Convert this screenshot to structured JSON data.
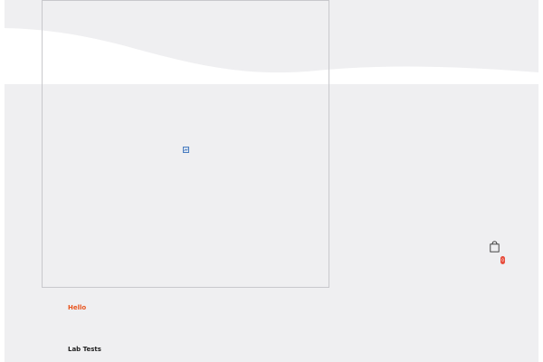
{
  "colors": {
    "background": "#ffffff",
    "panel": "#efeff1",
    "accent": "#e8541e",
    "badge": "#e74c3c",
    "text": "#222222"
  },
  "media": {
    "image_status": "broken-image",
    "icon": "broken-image-icon"
  },
  "header": {
    "cart_icon": "shopping-bag-icon",
    "cart_count": "0"
  },
  "main": {
    "greeting": "Hello",
    "section_title": "Lab Tests"
  }
}
